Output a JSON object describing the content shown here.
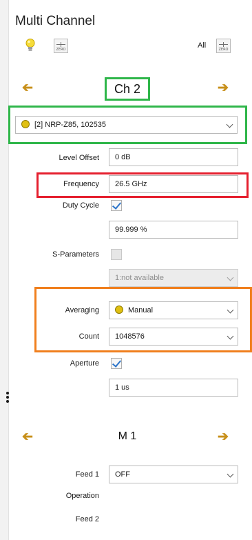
{
  "panel": {
    "title": "Multi Channel",
    "all_label": "All",
    "zero_label": "ZERO"
  },
  "channel": {
    "label": "Ch 2",
    "sensor": "[2] NRP-Z85, 102535"
  },
  "fields": {
    "level_offset": {
      "label": "Level Offset",
      "value": "0 dB"
    },
    "frequency": {
      "label": "Frequency",
      "value": "26.5 GHz"
    },
    "duty_cycle": {
      "label": "Duty Cycle",
      "checked": true,
      "value": "99.999 %"
    },
    "s_parameters": {
      "label": "S-Parameters",
      "checked": false,
      "value": "1:not available"
    },
    "averaging": {
      "label": "Averaging",
      "value": "Manual"
    },
    "count": {
      "label": "Count",
      "value": "1048576"
    },
    "aperture": {
      "label": "Aperture",
      "checked": true,
      "value": "1 us"
    }
  },
  "measurement": {
    "label": "M 1",
    "feed1": {
      "label": "Feed 1",
      "value": "OFF"
    },
    "operation_label": "Operation",
    "feed2_label": "Feed 2"
  },
  "colors": {
    "highlight_green": "#2fb64a",
    "highlight_red": "#e51f2e",
    "highlight_orange": "#f07f1d",
    "arrow": "#c8901a",
    "check": "#2a73c9",
    "status_dot": "#e0c012"
  },
  "icons": {
    "bulb": "lightbulb-icon",
    "zero": "zero-icon",
    "prev": "arrow-left-icon",
    "next": "arrow-right-icon",
    "dropdown": "chevron-down-icon"
  }
}
